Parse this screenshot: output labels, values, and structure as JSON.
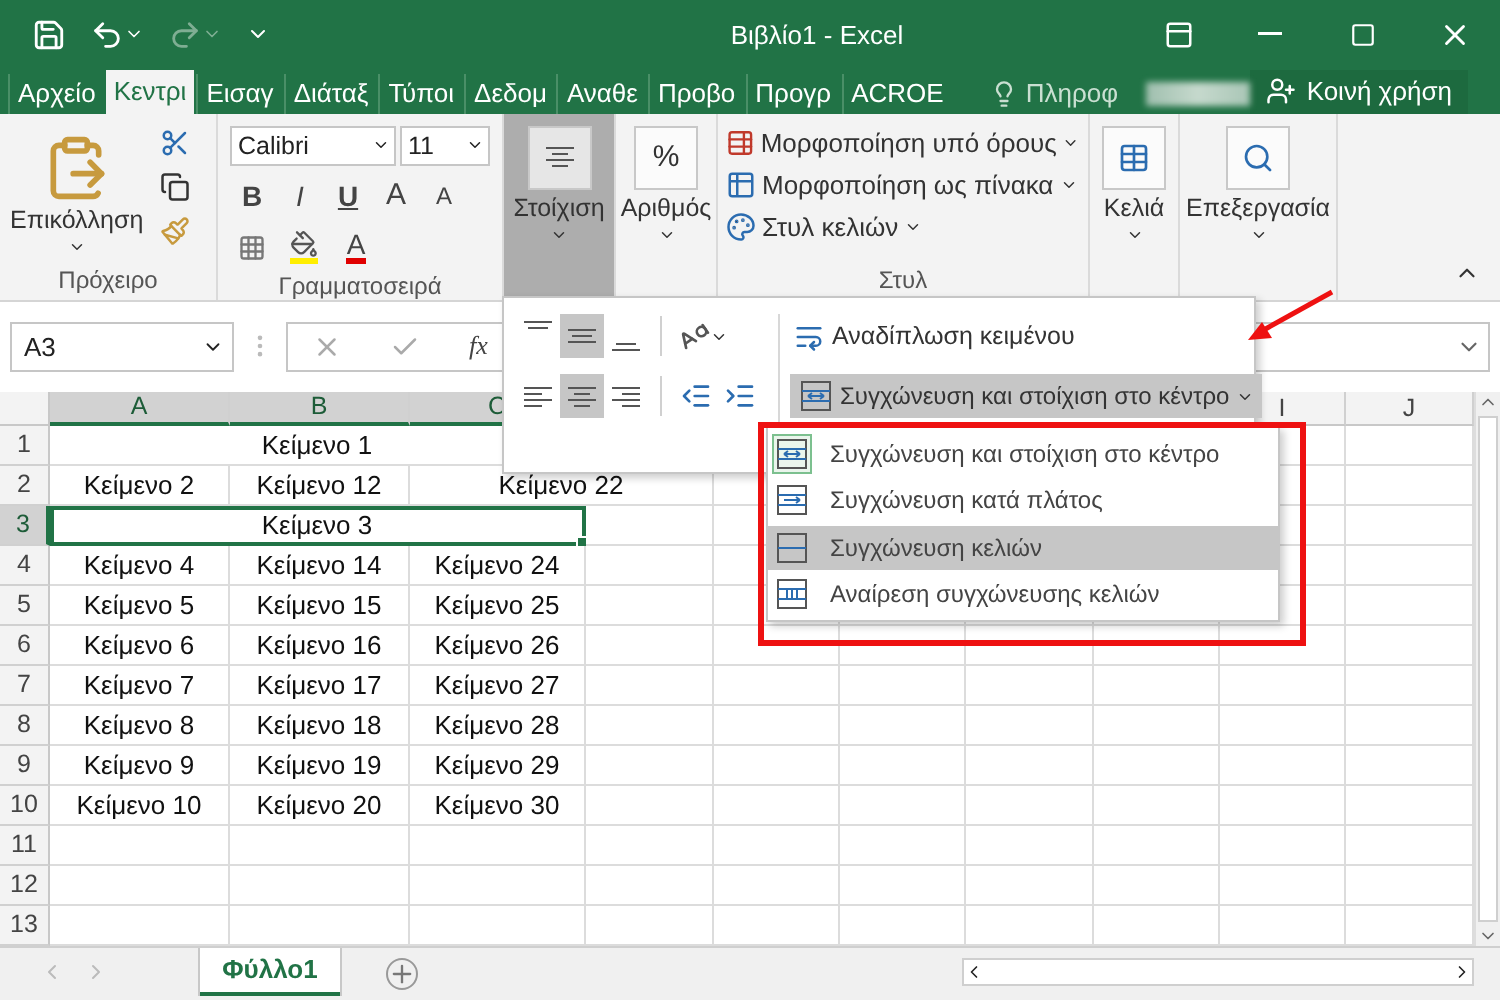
{
  "title_bar": {
    "title": "Βιβλίο1 - Excel"
  },
  "quick_access": [
    {
      "kind": "save",
      "disabled": false
    },
    {
      "kind": "undo",
      "disabled": false
    },
    {
      "kind": "redo",
      "disabled": true
    },
    {
      "kind": "customize",
      "disabled": false
    }
  ],
  "tabs": [
    {
      "label": "Αρχείο",
      "selected": false
    },
    {
      "label": "Κεντρι",
      "selected": true
    },
    {
      "label": "Εισαγ",
      "selected": false
    },
    {
      "label": "Διάταξ",
      "selected": false
    },
    {
      "label": "Τύποι",
      "selected": false
    },
    {
      "label": "Δεδομ",
      "selected": false
    },
    {
      "label": "Αναθε",
      "selected": false
    },
    {
      "label": "Προβο",
      "selected": false
    },
    {
      "label": "Προγρ",
      "selected": false
    },
    {
      "label": "ACROE",
      "selected": false
    }
  ],
  "tell_me": "Πληροφ",
  "share_button": "Κοινή χρήση",
  "ribbon": {
    "clipboard": {
      "paste": "Επικόλληση",
      "label": "Πρόχειρο"
    },
    "font": {
      "name": "Calibri",
      "size": "11",
      "bold": "B",
      "italic": "I",
      "underline": "U",
      "grow": "A",
      "shrink": "A",
      "font_color": "A",
      "label": "Γραμματοσειρά"
    },
    "alignment": {
      "label": "Στοίχιση",
      "pressed": true
    },
    "number": {
      "symbol": "%",
      "label": "Αριθμός"
    },
    "styles": {
      "items": [
        {
          "kind": "conditional",
          "label": "Μορφοποίηση υπό όρους"
        },
        {
          "kind": "table",
          "label": "Μορφοποίηση ως πίνακα"
        },
        {
          "kind": "cell",
          "label": "Στυλ κελιών"
        }
      ],
      "label": "Στυλ"
    },
    "cells": {
      "label": "Κελιά"
    },
    "editing": {
      "label": "Επεξεργασία"
    }
  },
  "formula_bar": {
    "name_box": "A3",
    "fx": "fx"
  },
  "alignment_popup": {
    "vertical": [
      {
        "kind": "top",
        "selected": false
      },
      {
        "kind": "middle",
        "selected": true
      },
      {
        "kind": "bottom",
        "selected": false
      }
    ],
    "horizontal": [
      {
        "kind": "left",
        "selected": false
      },
      {
        "kind": "center",
        "selected": true
      },
      {
        "kind": "right",
        "selected": false
      }
    ],
    "wrap_text": "Αναδίπλωση κειμένου",
    "merge_button": {
      "label": "Συγχώνευση και στοίχιση στο κέντρο",
      "open": true
    }
  },
  "merge_menu": [
    {
      "kind": "merge_center",
      "label": "Συγχώνευση και στοίχιση στο κέντρο",
      "checked": true,
      "selected": false
    },
    {
      "kind": "merge_across",
      "label": "Συγχώνευση κατά πλάτος",
      "checked": false,
      "selected": false
    },
    {
      "kind": "merge_cells",
      "label": "Συγχώνευση κελιών",
      "checked": false,
      "selected": true
    },
    {
      "kind": "unmerge",
      "label": "Αναίρεση συγχώνευσης κελιών",
      "checked": false,
      "selected": false
    }
  ],
  "sheet": {
    "columns": [
      {
        "label": "A",
        "selected": true
      },
      {
        "label": "B",
        "selected": true
      },
      {
        "label": "C",
        "selected": true
      },
      {
        "label": "I",
        "selected": false
      },
      {
        "label": "J",
        "selected": false
      }
    ],
    "rows": [
      {
        "number": "1",
        "selected": false,
        "cells": [
          {
            "text": "Κείμενο 1",
            "selected": false
          },
          {
            "merged": true
          },
          {
            "merged": true
          }
        ]
      },
      {
        "number": "2",
        "selected": false,
        "cells": [
          {
            "text": "Κείμενο 2",
            "selected": false
          },
          {
            "text": "Κείμενο 12",
            "selected": false
          },
          {
            "text": "Κείμενο 22",
            "selected": false
          },
          {
            "merged": true
          }
        ]
      },
      {
        "number": "3",
        "selected": true,
        "cells": [
          {
            "text": "Κείμενο 3",
            "selected": true
          },
          {
            "merged": true
          },
          {
            "merged": true
          }
        ]
      },
      {
        "number": "4",
        "selected": false,
        "cells": [
          {
            "text": "Κείμενο 4",
            "selected": false
          },
          {
            "text": "Κείμενο 14",
            "selected": false
          },
          {
            "text": "Κείμενο 24",
            "selected": false
          }
        ]
      },
      {
        "number": "5",
        "selected": false,
        "cells": [
          {
            "text": "Κείμενο 5",
            "selected": false
          },
          {
            "text": "Κείμενο 15",
            "selected": false
          },
          {
            "text": "Κείμενο 25",
            "selected": false
          }
        ]
      },
      {
        "number": "6",
        "selected": false,
        "cells": [
          {
            "text": "Κείμενο 6",
            "selected": false
          },
          {
            "text": "Κείμενο 16",
            "selected": false
          },
          {
            "text": "Κείμενο 26",
            "selected": false
          }
        ]
      },
      {
        "number": "7",
        "selected": false,
        "cells": [
          {
            "text": "Κείμενο 7",
            "selected": false
          },
          {
            "text": "Κείμενο 17",
            "selected": false
          },
          {
            "text": "Κείμενο 27",
            "selected": false
          }
        ]
      },
      {
        "number": "8",
        "selected": false,
        "cells": [
          {
            "text": "Κείμενο 8",
            "selected": false
          },
          {
            "text": "Κείμενο 18",
            "selected": false
          },
          {
            "text": "Κείμενο 28",
            "selected": false
          }
        ]
      },
      {
        "number": "9",
        "selected": false,
        "cells": [
          {
            "text": "Κείμενο 9",
            "selected": false
          },
          {
            "text": "Κείμενο 19",
            "selected": false
          },
          {
            "text": "Κείμενο 29",
            "selected": false
          }
        ]
      },
      {
        "number": "10",
        "selected": false,
        "cells": [
          {
            "text": "Κείμενο 10",
            "selected": false
          },
          {
            "text": "Κείμενο 20",
            "selected": false
          },
          {
            "text": "Κείμενο 30",
            "selected": false
          }
        ]
      },
      {
        "number": "11",
        "selected": false,
        "cells": []
      },
      {
        "number": "12",
        "selected": false,
        "cells": []
      },
      {
        "number": "13",
        "selected": false,
        "cells": []
      }
    ],
    "sheet_tabs": [
      {
        "label": "Φύλλο1",
        "selected": true
      }
    ]
  }
}
